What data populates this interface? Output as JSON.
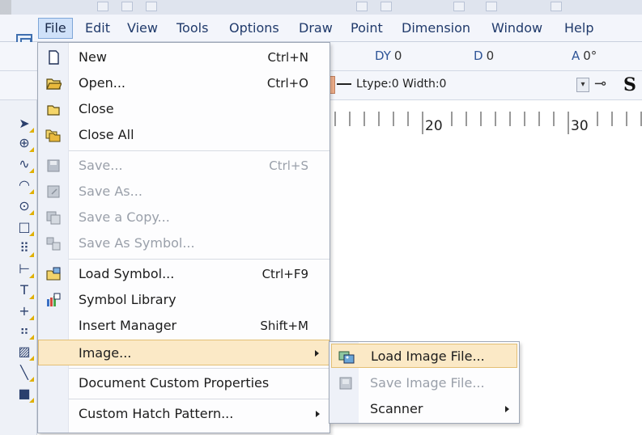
{
  "menubar": {
    "items": [
      {
        "label": "File",
        "active": true
      },
      {
        "label": "Edit"
      },
      {
        "label": "View"
      },
      {
        "label": "Tools"
      },
      {
        "label": "Options"
      },
      {
        "label": "Draw"
      },
      {
        "label": "Point"
      },
      {
        "label": "Dimension"
      },
      {
        "label": "Window"
      },
      {
        "label": "Help"
      }
    ]
  },
  "toolbar": {
    "dy_label": "DY",
    "dy_value": "0",
    "d_label": "D",
    "d_value": "0",
    "a_label": "A",
    "a_value": "0°",
    "ltype_text": "Ltype:0 Width:0",
    "bold_s": "S"
  },
  "ruler": {
    "labels": [
      "20",
      "30"
    ]
  },
  "file_menu": {
    "items": [
      {
        "label": "New",
        "shortcut": "Ctrl+N",
        "icon": "new-document-icon"
      },
      {
        "label": "Open...",
        "shortcut": "Ctrl+O",
        "icon": "open-folder-icon"
      },
      {
        "label": "Close",
        "shortcut": "",
        "icon": "close-folder-icon"
      },
      {
        "label": "Close All",
        "shortcut": "",
        "icon": "close-all-icon"
      },
      {
        "label": "Save...",
        "shortcut": "Ctrl+S",
        "icon": "save-icon",
        "disabled": true
      },
      {
        "label": "Save As...",
        "shortcut": "",
        "icon": "save-as-icon",
        "disabled": true
      },
      {
        "label": "Save a Copy...",
        "shortcut": "",
        "icon": "save-copy-icon",
        "disabled": true
      },
      {
        "label": "Save As Symbol...",
        "shortcut": "",
        "icon": "save-symbol-icon",
        "disabled": true
      },
      {
        "label": "Load Symbol...",
        "shortcut": "Ctrl+F9",
        "icon": "load-symbol-icon"
      },
      {
        "label": "Symbol Library",
        "shortcut": "",
        "icon": "symbol-library-icon"
      },
      {
        "label": "Insert Manager",
        "shortcut": "Shift+M",
        "icon": ""
      },
      {
        "label": "Image...",
        "shortcut": "",
        "icon": "",
        "submenu": true,
        "highlighted": true
      },
      {
        "label": "Document Custom Properties",
        "shortcut": "",
        "icon": ""
      },
      {
        "label": "Custom Hatch Pattern...",
        "shortcut": "",
        "icon": "",
        "submenu": true
      }
    ]
  },
  "image_submenu": {
    "items": [
      {
        "label": "Load Image File...",
        "icon": "load-image-icon",
        "highlighted": true
      },
      {
        "label": "Save Image File...",
        "icon": "save-image-icon",
        "disabled": true
      },
      {
        "label": "Scanner",
        "icon": "",
        "submenu": true
      }
    ]
  },
  "colors": {
    "menu_highlight": "#fbe9c6",
    "menu_highlight_border": "#e3bf74",
    "menubar_active": "#cfe1f9",
    "menubar_text": "#203a6b"
  }
}
